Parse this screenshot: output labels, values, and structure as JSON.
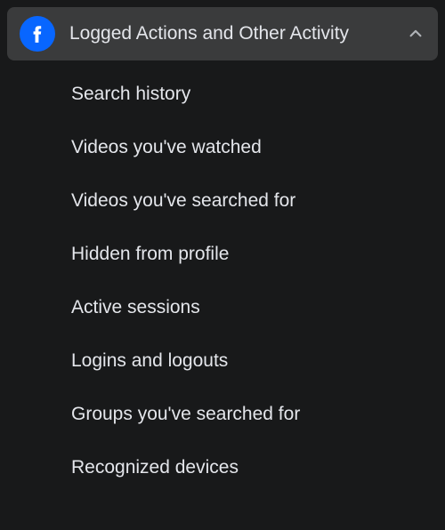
{
  "section": {
    "title": "Logged Actions and Other Activity",
    "icon": "facebook-icon",
    "expanded": true,
    "items": [
      {
        "label": "Search history"
      },
      {
        "label": "Videos you've watched"
      },
      {
        "label": "Videos you've searched for"
      },
      {
        "label": "Hidden from profile"
      },
      {
        "label": "Active sessions"
      },
      {
        "label": "Logins and logouts"
      },
      {
        "label": "Groups you've searched for"
      },
      {
        "label": "Recognized devices"
      }
    ]
  }
}
